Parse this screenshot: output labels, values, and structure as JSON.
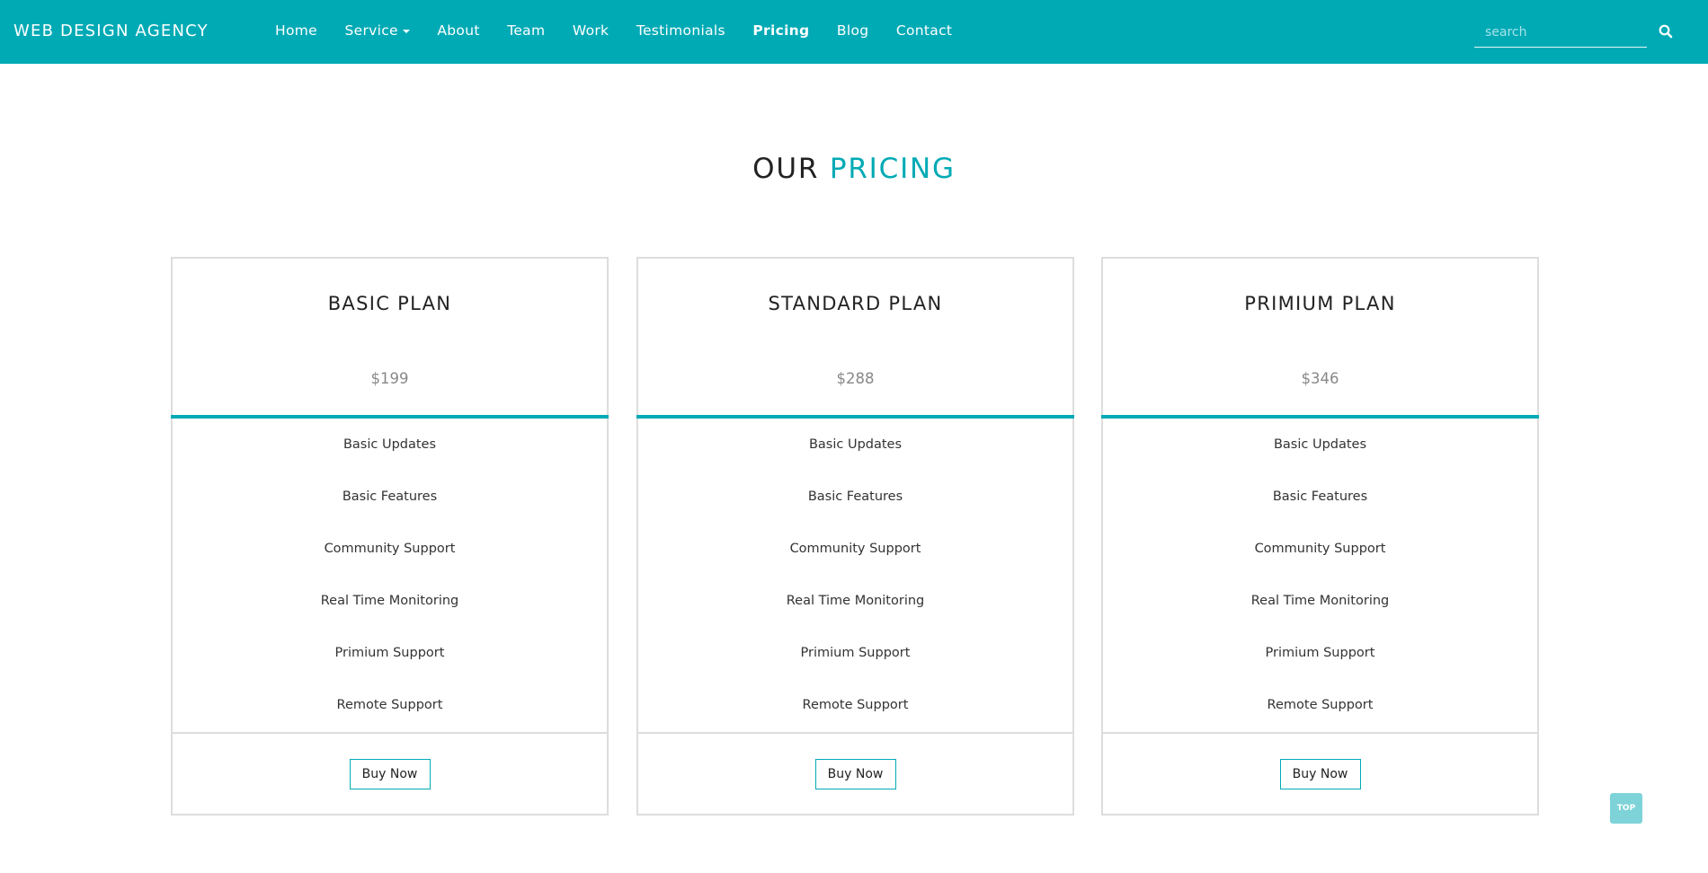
{
  "brand": "WEB DESIGN AGENCY",
  "nav": {
    "items": [
      {
        "label": "Home"
      },
      {
        "label": "Service",
        "has_dropdown": true
      },
      {
        "label": "About"
      },
      {
        "label": "Team"
      },
      {
        "label": "Work"
      },
      {
        "label": "Testimonials"
      },
      {
        "label": "Pricing",
        "active": true
      },
      {
        "label": "Blog"
      },
      {
        "label": "Contact"
      }
    ]
  },
  "search": {
    "placeholder": "search",
    "value": "",
    "icon": "search-icon"
  },
  "section": {
    "title_prefix": "OUR",
    "title_accent": "PRICING"
  },
  "plans": [
    {
      "name": "BASIC PLAN",
      "price": "$199",
      "features": [
        "Basic Updates",
        "Basic Features",
        "Community Support",
        "Real Time Monitoring",
        "Primium Support",
        "Remote Support"
      ],
      "button_label": "Buy Now"
    },
    {
      "name": "STANDARD PLAN",
      "price": "$288",
      "features": [
        "Basic Updates",
        "Basic Features",
        "Community Support",
        "Real Time Monitoring",
        "Primium Support",
        "Remote Support"
      ],
      "button_label": "Buy Now"
    },
    {
      "name": "PRIMIUM PLAN",
      "price": "$346",
      "features": [
        "Basic Updates",
        "Basic Features",
        "Community Support",
        "Real Time Monitoring",
        "Primium Support",
        "Remote Support"
      ],
      "button_label": "Buy Now"
    }
  ],
  "top_button": "TOP",
  "colors": {
    "accent": "#00aab5",
    "border": "#dddddd",
    "top_button": "#7ed3d8"
  }
}
